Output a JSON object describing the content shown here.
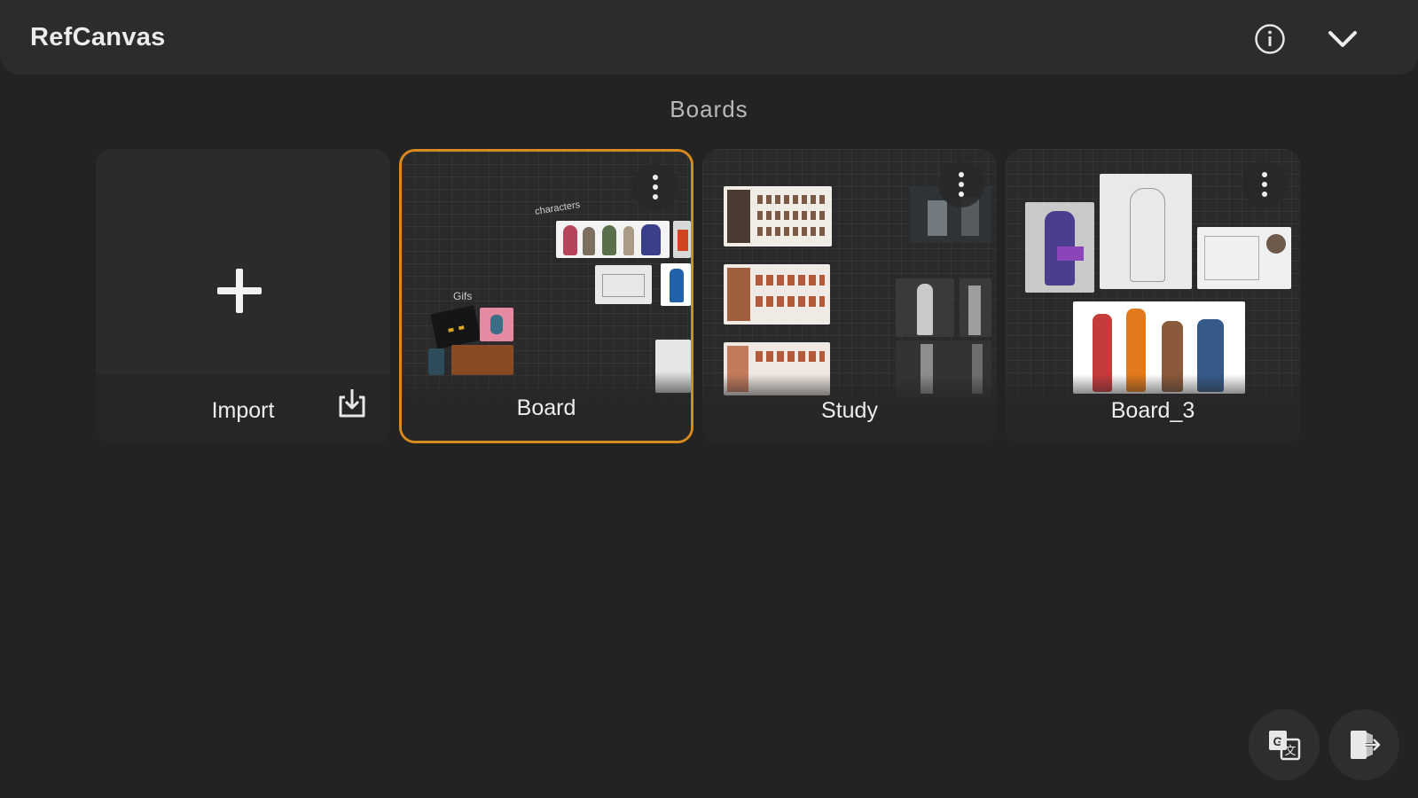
{
  "app": {
    "title": "RefCanvas"
  },
  "header": {
    "info_icon": "info-icon",
    "collapse_icon": "chevron-down-icon"
  },
  "boards_section": {
    "title": "Boards"
  },
  "cards": {
    "import": {
      "label": "Import",
      "icon": "plus-icon",
      "action_icon": "import-icon"
    },
    "board": {
      "label": "Board",
      "selected": true,
      "annotations": [
        "characters",
        "Gifs"
      ]
    },
    "study": {
      "label": "Study"
    },
    "board_3": {
      "label": "Board_3"
    }
  },
  "bottom_actions": {
    "translate_icon": "translate-icon",
    "exit_icon": "exit-icon"
  },
  "colors": {
    "background": "#232323",
    "topbar": "#2c2c2c",
    "card": "#2b2b2b",
    "selected_border": "#d98a1e"
  }
}
